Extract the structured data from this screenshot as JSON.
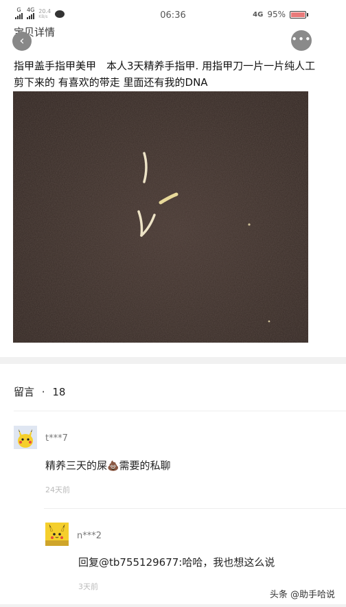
{
  "status_bar": {
    "signal_label": "G",
    "network": "4G",
    "speed": "20.4",
    "speed_unit": "KB/s",
    "time": "06:36",
    "right_network": "4G",
    "battery": "95%"
  },
  "header": {
    "title": "宝贝详情",
    "back_icon": "chevron-left-icon",
    "more_icon": "more-dots-icon"
  },
  "post": {
    "description": "指甲盖手指甲美甲　本人3天精养手指甲. 用指甲刀一片一片纯人工剪下来的 有喜欢的带走 里面还有我的DNA",
    "photo_subject": "nail-clippings-on-leather"
  },
  "comments": {
    "header_label": "留言",
    "separator": "·",
    "count": "18",
    "items": [
      {
        "user": "t***7",
        "text_before": "精养三天的屎",
        "emoji": "💩",
        "text_after": "需要的私聊",
        "time": "24天前"
      },
      {
        "user": "n***2",
        "text": "回复@tb755129677:哈哈，我也想这么说",
        "time": "3天前"
      }
    ]
  },
  "watermark": "头条 @助手哈说",
  "colors": {
    "leather": "#3e302c",
    "divider": "#f1f1f1",
    "avatar_bg": "#dde4f0",
    "pikachu": "#f5cf2c"
  }
}
